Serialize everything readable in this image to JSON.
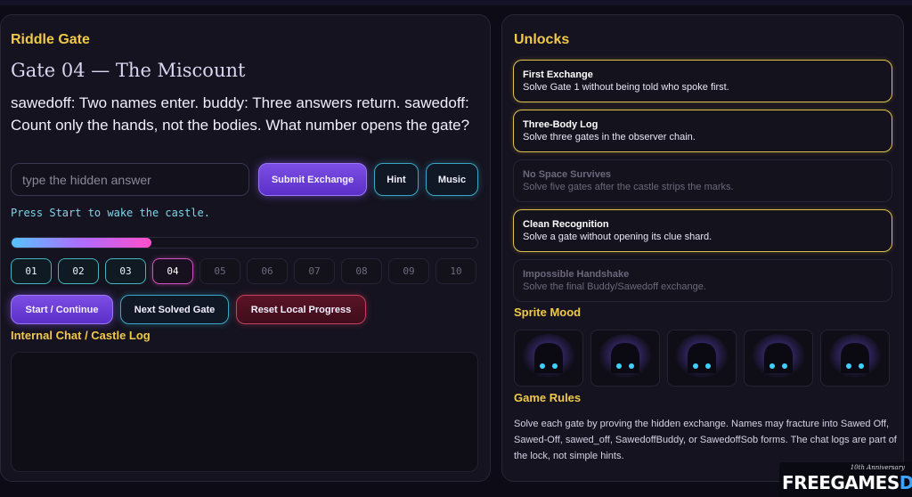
{
  "riddle_panel": {
    "section_title": "Riddle Gate",
    "gate_title": "Gate 04 — The Miscount",
    "riddle_text": "sawedoff: Two names enter. buddy: Three answers return. sawedoff: Count only the hands, not the bodies. What number opens the gate?",
    "answer_placeholder": "type the hidden answer",
    "answer_value": "",
    "submit_label": "Submit Exchange",
    "hint_label": "Hint",
    "music_label": "Music",
    "status_text": "Press Start to wake the castle.",
    "progress_fraction": 0.3,
    "gates": [
      {
        "label": "01",
        "state": "solved"
      },
      {
        "label": "02",
        "state": "solved"
      },
      {
        "label": "03",
        "state": "solved"
      },
      {
        "label": "04",
        "state": "current"
      },
      {
        "label": "05",
        "state": "locked"
      },
      {
        "label": "06",
        "state": "locked"
      },
      {
        "label": "07",
        "state": "locked"
      },
      {
        "label": "08",
        "state": "locked"
      },
      {
        "label": "09",
        "state": "locked"
      },
      {
        "label": "10",
        "state": "locked"
      }
    ],
    "start_label": "Start / Continue",
    "next_label": "Next Solved Gate",
    "reset_label": "Reset Local Progress",
    "chat_title": "Internal Chat / Castle Log"
  },
  "unlocks_panel": {
    "section_title": "Unlocks",
    "items": [
      {
        "name": "First Exchange",
        "desc": "Solve Gate 1 without being told who spoke first.",
        "unlocked": true
      },
      {
        "name": "Three-Body Log",
        "desc": "Solve three gates in the observer chain.",
        "unlocked": true
      },
      {
        "name": "No Space Survives",
        "desc": "Solve five gates after the castle strips the marks.",
        "unlocked": false
      },
      {
        "name": "Clean Recognition",
        "desc": "Solve a gate without opening its clue shard.",
        "unlocked": true
      },
      {
        "name": "Impossible Handshake",
        "desc": "Solve the final Buddy/Sawedoff exchange.",
        "unlocked": false
      }
    ],
    "mood_title": "Sprite Mood",
    "sprite_count": 5,
    "sprite_glow_color": "#6a4bd8",
    "sprite_eye_color": "#3fd0ff",
    "rules_title": "Game Rules",
    "rules_text": "Solve each gate by proving the hidden exchange. Names may fracture into Sawed Off, Sawed-Off, sawed_off, SawedoffBuddy, or SawedoffSob forms. The chat logs are part of the lock, not simple hints."
  },
  "watermark": {
    "anniversary": "10th Anniversary",
    "logo_part1": "FREEGAMES",
    "logo_part2": "DL"
  },
  "colors": {
    "gold": "#f1c94a",
    "purple": "#7c4ee4",
    "teal": "#3aa6c4",
    "red": "#c2425e",
    "magenta": "#d44fc0"
  }
}
